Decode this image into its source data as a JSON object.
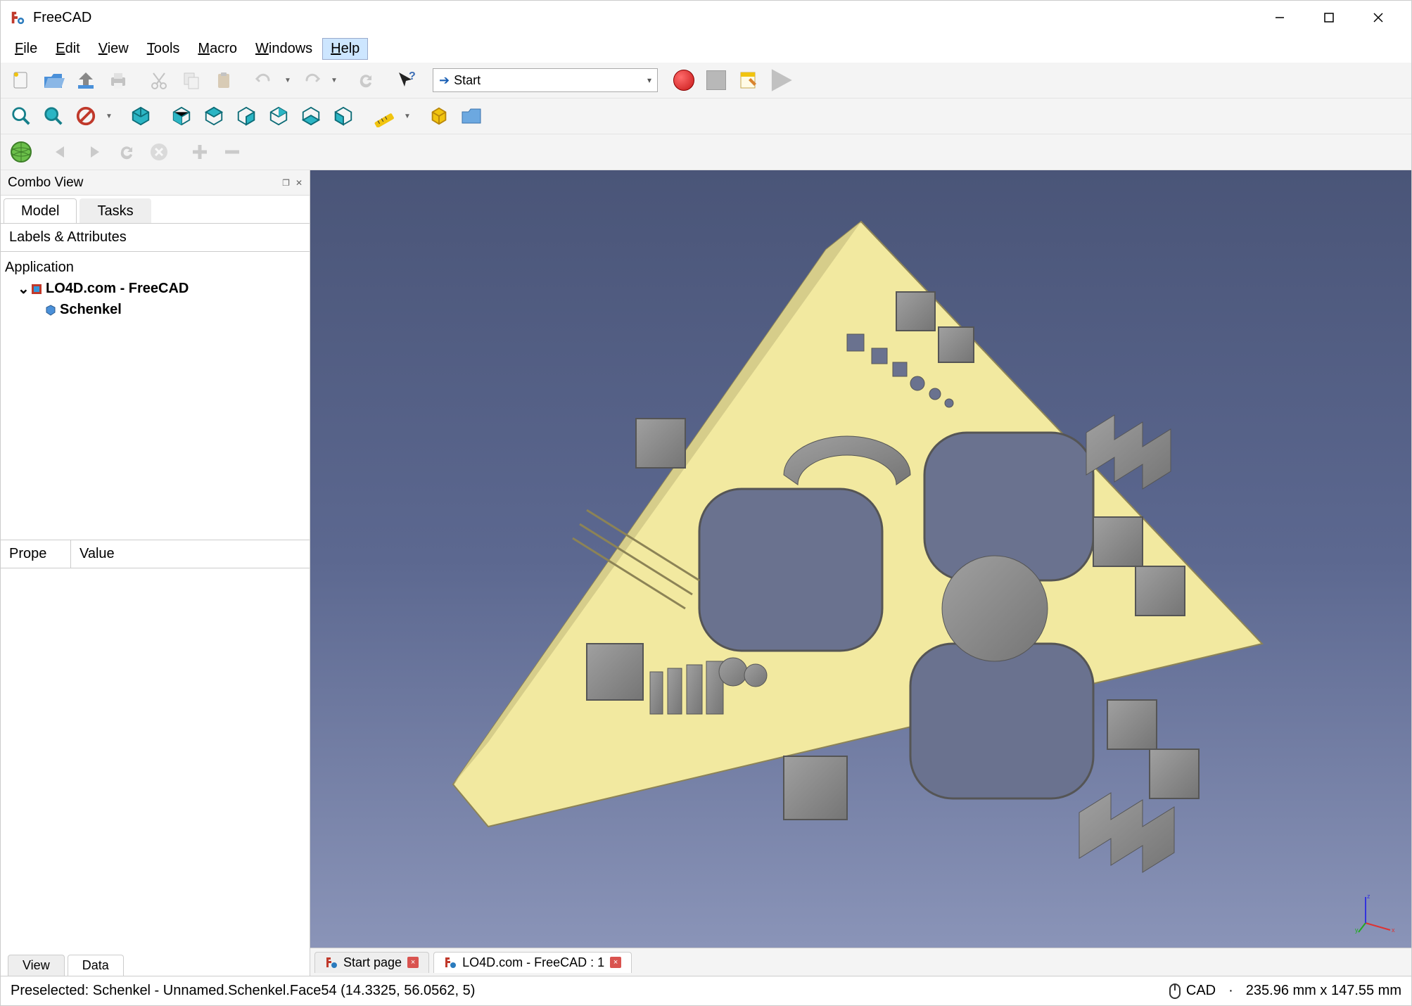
{
  "app": {
    "title": "FreeCAD"
  },
  "menu": {
    "file": "File",
    "edit": "Edit",
    "view": "View",
    "tools": "Tools",
    "macro": "Macro",
    "windows": "Windows",
    "help": "Help"
  },
  "workbench": {
    "selected": "Start"
  },
  "combo": {
    "title": "Combo View",
    "tab_model": "Model",
    "tab_tasks": "Tasks",
    "tree_header": "Labels & Attributes",
    "tree": {
      "app_root": "Application",
      "doc": "LO4D.com - FreeCAD",
      "item": "Schenkel"
    },
    "prop_col1": "Prope",
    "prop_col2": "Value",
    "prop_tab_view": "View",
    "prop_tab_data": "Data"
  },
  "doc_tabs": {
    "tab1": "Start page",
    "tab2": "LO4D.com - FreeCAD : 1"
  },
  "status": {
    "preselected": "Preselected: Schenkel - Unnamed.Schenkel.Face54 (14.3325, 56.0562, 5)",
    "nav_mode": "CAD",
    "dims": "235.96 mm x 147.55 mm"
  }
}
